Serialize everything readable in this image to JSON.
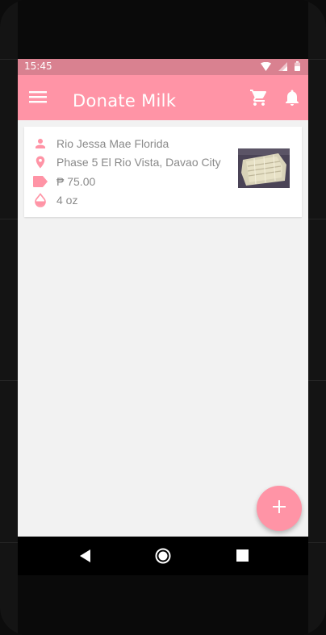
{
  "status_bar": {
    "time": "15:45",
    "icons": [
      "wifi-icon",
      "signal-icon",
      "battery-icon"
    ]
  },
  "app_bar": {
    "title": "Donate Milk",
    "left_icon": "menu-icon",
    "right_icons": [
      "cart-icon",
      "bell-icon"
    ]
  },
  "listing": {
    "donor_name": "Rio Jessa Mae Florida",
    "address": "Phase 5 El Rio Vista, Davao City",
    "price": "₱ 75.00",
    "volume": "4 oz",
    "icons": [
      "person-icon",
      "location-pin-icon",
      "price-tag-icon",
      "drop-icon"
    ]
  },
  "fab": {
    "icon": "add-icon",
    "symbol": "+"
  },
  "nav_bar": {
    "icons": [
      "back-icon",
      "home-icon",
      "recents-icon"
    ]
  },
  "colors": {
    "primary": "#ff94a6",
    "status_bar": "#d98190",
    "background": "#f2f2f2",
    "text_secondary": "#8a8a8a"
  }
}
